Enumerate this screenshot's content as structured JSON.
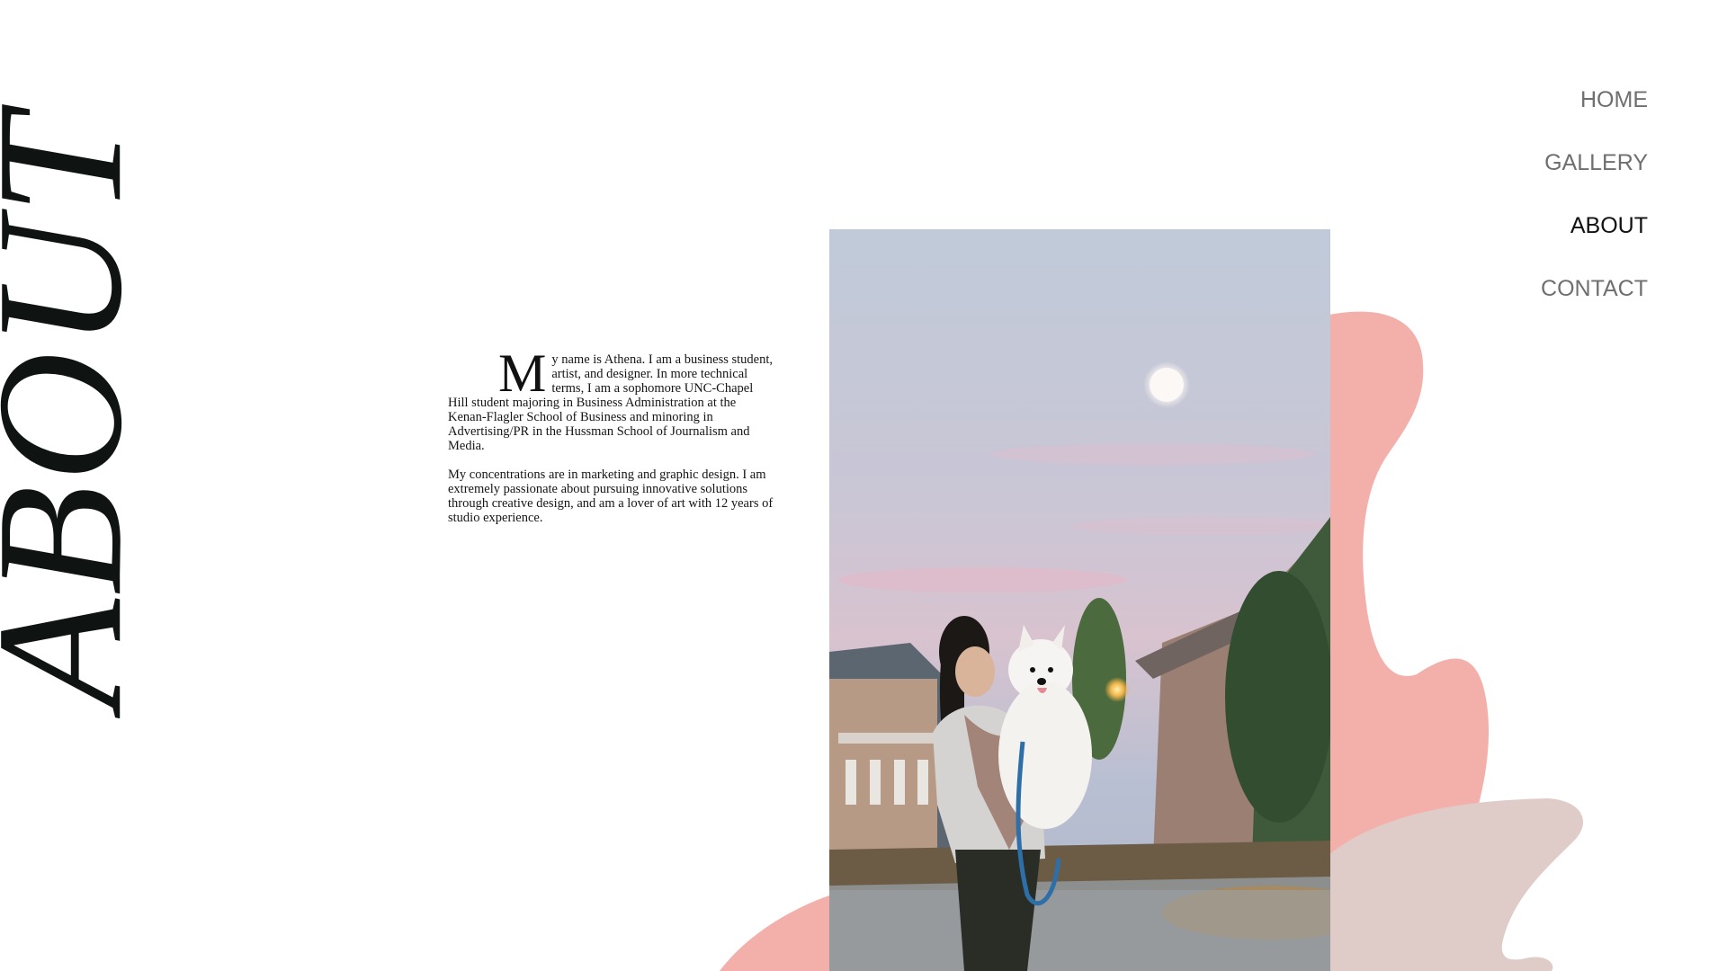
{
  "page": {
    "heading": "ABOUT"
  },
  "nav": {
    "items": [
      {
        "label": "HOME",
        "active": false
      },
      {
        "label": "GALLERY",
        "active": false
      },
      {
        "label": "ABOUT",
        "active": true
      },
      {
        "label": "CONTACT",
        "active": false
      }
    ]
  },
  "bio": {
    "dropcap": "M",
    "paragraph1": "y name is Athena. I am a business student, artist, and designer. In more technical terms, I am a sophomore UNC-Chapel Hill student majoring in Business Administration at the Kenan-Flagler School of Business and minoring in Advertising/PR in the Hussman School of Journalism and Media.",
    "paragraph2": "My concentrations are in marketing and graphic design. I am extremely passionate about pursuing innovative solutions through creative design, and am a lover of art with 12 years of studio experience."
  },
  "colors": {
    "blob_pink": "#f3b0ab",
    "blob_taupe": "#dfcbc7",
    "text_dark": "#0f1412",
    "nav_gray": "#6f6f6f",
    "nav_active": "#111111"
  },
  "photo": {
    "subject": "person holding white fluffy dog outdoors at dusk with moon in sky"
  }
}
